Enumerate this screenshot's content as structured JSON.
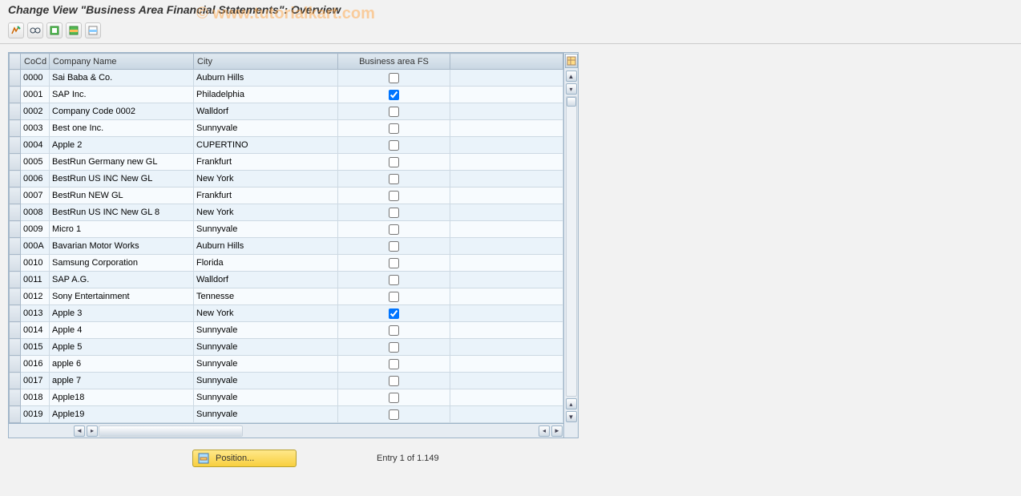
{
  "title": "Change View \"Business Area Financial Statements\": Overview",
  "watermark": "© www.tutorialkart.com",
  "toolbar": {
    "icons": [
      "toggle-icon",
      "glasses-icon",
      "select-all-icon",
      "select-block-icon",
      "deselect-icon"
    ]
  },
  "table": {
    "headers": {
      "cocd": "CoCd",
      "company_name": "Company Name",
      "city": "City",
      "business_area_fs": "Business area FS"
    },
    "rows": [
      {
        "cocd": "0000",
        "name": "Sai Baba & Co.",
        "city": "Auburn Hills",
        "fs": false
      },
      {
        "cocd": "0001",
        "name": "SAP Inc.",
        "city": "Philadelphia",
        "fs": true
      },
      {
        "cocd": "0002",
        "name": "Company Code 0002",
        "city": "Walldorf",
        "fs": false
      },
      {
        "cocd": "0003",
        "name": "Best one Inc.",
        "city": "Sunnyvale",
        "fs": false
      },
      {
        "cocd": "0004",
        "name": "Apple 2",
        "city": "CUPERTINO",
        "fs": false
      },
      {
        "cocd": "0005",
        "name": "BestRun Germany new GL",
        "city": "Frankfurt",
        "fs": false
      },
      {
        "cocd": "0006",
        "name": "BestRun US INC New GL",
        "city": "New York",
        "fs": false
      },
      {
        "cocd": "0007",
        "name": "BestRun NEW GL",
        "city": "Frankfurt",
        "fs": false
      },
      {
        "cocd": "0008",
        "name": "BestRun US INC New GL 8",
        "city": "New York",
        "fs": false
      },
      {
        "cocd": "0009",
        "name": "Micro 1",
        "city": "Sunnyvale",
        "fs": false
      },
      {
        "cocd": "000A",
        "name": "Bavarian Motor Works",
        "city": "Auburn Hills",
        "fs": false
      },
      {
        "cocd": "0010",
        "name": "Samsung Corporation",
        "city": "Florida",
        "fs": false
      },
      {
        "cocd": "0011",
        "name": "SAP A.G.",
        "city": "Walldorf",
        "fs": false
      },
      {
        "cocd": "0012",
        "name": "Sony Entertainment",
        "city": "Tennesse",
        "fs": false
      },
      {
        "cocd": "0013",
        "name": "Apple 3",
        "city": "New York",
        "fs": true
      },
      {
        "cocd": "0014",
        "name": "Apple 4",
        "city": "Sunnyvale",
        "fs": false
      },
      {
        "cocd": "0015",
        "name": "Apple 5",
        "city": "Sunnyvale",
        "fs": false
      },
      {
        "cocd": "0016",
        "name": "apple 6",
        "city": "Sunnyvale",
        "fs": false
      },
      {
        "cocd": "0017",
        "name": "apple 7",
        "city": "Sunnyvale",
        "fs": false
      },
      {
        "cocd": "0018",
        "name": "Apple18",
        "city": "Sunnyvale",
        "fs": false
      },
      {
        "cocd": "0019",
        "name": "Apple19",
        "city": "Sunnyvale",
        "fs": false
      }
    ]
  },
  "footer": {
    "position_label": "Position...",
    "entry_text": "Entry 1 of 1.149"
  }
}
